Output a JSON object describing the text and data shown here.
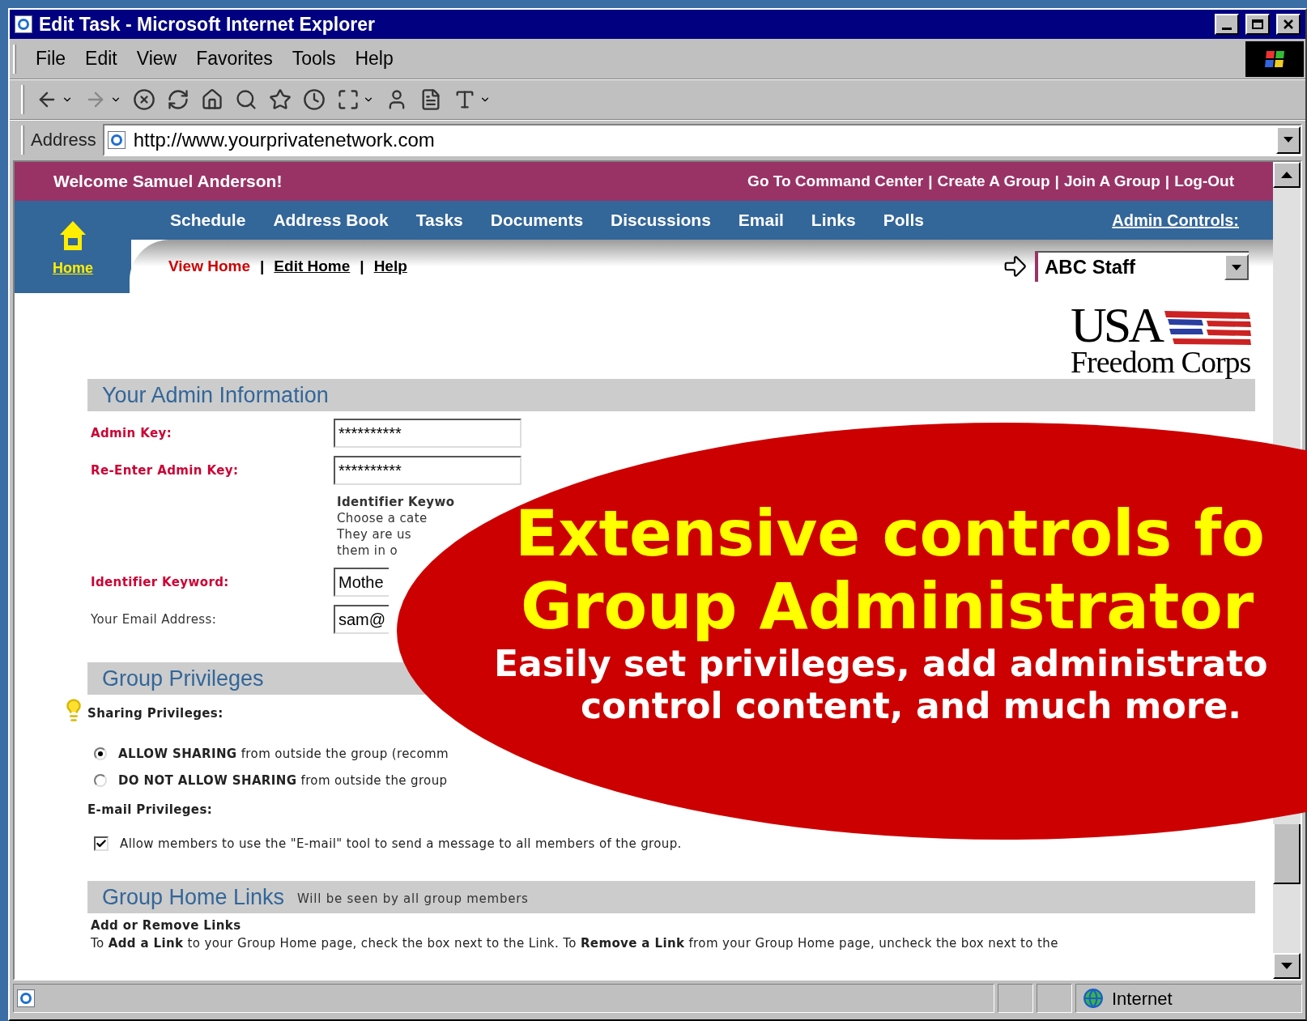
{
  "window": {
    "title": "Edit Task - Microsoft Internet Explorer"
  },
  "menu": [
    "File",
    "Edit",
    "View",
    "Favorites",
    "Tools",
    "Help"
  ],
  "address": {
    "label": "Address",
    "value": "http://www.yourprivatenetwork.com"
  },
  "header": {
    "welcome": "Welcome Samuel Anderson!",
    "separator": "|",
    "links": [
      "Go To Command Center",
      "Create A Group",
      "Join A Group",
      "Log-Out"
    ]
  },
  "nav": {
    "home": "Home",
    "items": [
      "Schedule",
      "Address Book",
      "Tasks",
      "Documents",
      "Discussions",
      "Email",
      "Links",
      "Polls"
    ],
    "admin": "Admin Controls:"
  },
  "subnav": {
    "separator": "|",
    "links": [
      {
        "label": "View Home",
        "selected": true
      },
      {
        "label": "Edit Home",
        "selected": false
      },
      {
        "label": "Help",
        "selected": false
      }
    ]
  },
  "group_select": {
    "value": "ABC Staff"
  },
  "logo": {
    "line1": "USA",
    "line2": "Freedom Corps"
  },
  "admin_info": {
    "title": "Your Admin Information",
    "fields": [
      {
        "kind": "field",
        "label": "Admin Key:",
        "required": true,
        "value": "**********"
      },
      {
        "kind": "field",
        "label": "Re-Enter Admin Key:",
        "required": true,
        "value": "**********"
      },
      {
        "kind": "help",
        "lines": [
          "Identifier Keywo",
          "Choose a cate",
          "They are us",
          "them in o"
        ]
      },
      {
        "kind": "field",
        "label": "Identifier Keyword:",
        "required": true,
        "value": "Mothe"
      },
      {
        "kind": "field",
        "label": "Your Email Address:",
        "required": false,
        "value": "sam@"
      }
    ]
  },
  "privileges": {
    "title": "Group Privileges",
    "sharing_label": "Sharing Privileges:",
    "options": [
      {
        "text": "**ALLOW SHARING** from outside the group (recomm",
        "selected": true
      },
      {
        "text": "**DO NOT ALLOW SHARING** from outside the group",
        "selected": false
      }
    ],
    "email_label": "E-mail Privileges:",
    "email_option": {
      "text": "Allow members to use the \"E-mail\" tool to send a message to all members of the group.",
      "checked": true
    }
  },
  "links_section": {
    "title": "Group Home Links",
    "subtitle": "Will be seen by all group members",
    "heading": "Add or Remove Links",
    "text": "To **Add a Link** to your Group Home page, check the box next to the Link. To **Remove a Link** from your Group Home page, uncheck the box next to the"
  },
  "status_bar": {
    "zone": "Internet"
  },
  "overlay": {
    "headline": [
      "Extensive controls fo",
      "Group Administrator"
    ],
    "subline": [
      "Easily set privileges, add administrato",
      "control content, and much more."
    ]
  }
}
